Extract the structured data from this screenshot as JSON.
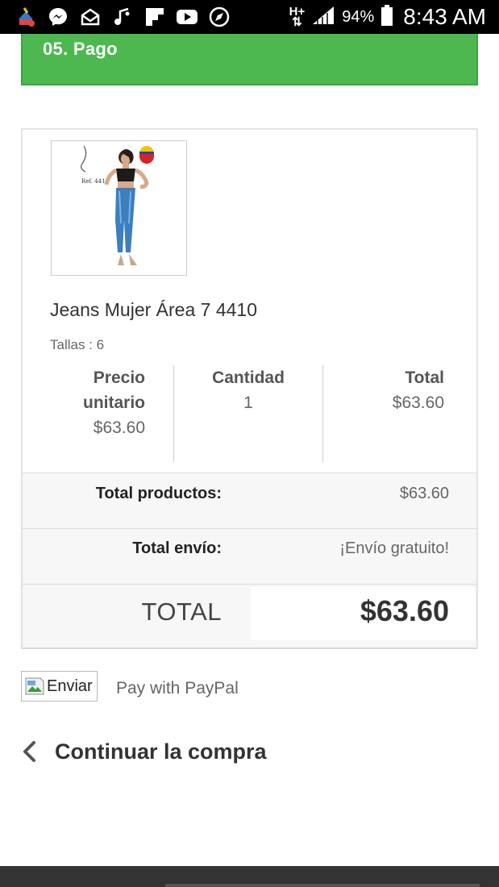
{
  "status_bar": {
    "network_type": "H+",
    "battery_percent": "94%",
    "time": "8:43 AM",
    "icons": [
      "cleaner-app-icon",
      "messenger-icon",
      "mail-icon",
      "music-app-icon",
      "flipboard-icon",
      "youtube-icon",
      "browser-icon",
      "network-arrows-icon",
      "signal-icon",
      "battery-icon"
    ]
  },
  "step": {
    "title": "05. Pago"
  },
  "product": {
    "image_alt": "Jeans Mujer Área 7 4410",
    "image_caption": "Ref. 4410",
    "name": "Jeans Mujer Área 7 4410",
    "size": "Tallas : 6",
    "unit_price_label": "Precio unitario",
    "unit_price": "$63.60",
    "quantity_label": "Cantidad",
    "quantity": "1",
    "total_label": "Total",
    "total": "$63.60"
  },
  "summary": {
    "products_label": "Total productos:",
    "products_value": "$63.60",
    "shipping_label": "Total envío:",
    "shipping_value": "¡Envío gratuito!",
    "total_label": "TOTAL",
    "total_value": "$63.60"
  },
  "payment": {
    "submit_label": "Enviar",
    "paypal_label": "Pay with PayPal"
  },
  "navigation": {
    "continue_label": "Continuar la compra"
  },
  "colors": {
    "accent_green": "#4cb84f",
    "status_bar": "#000000"
  }
}
